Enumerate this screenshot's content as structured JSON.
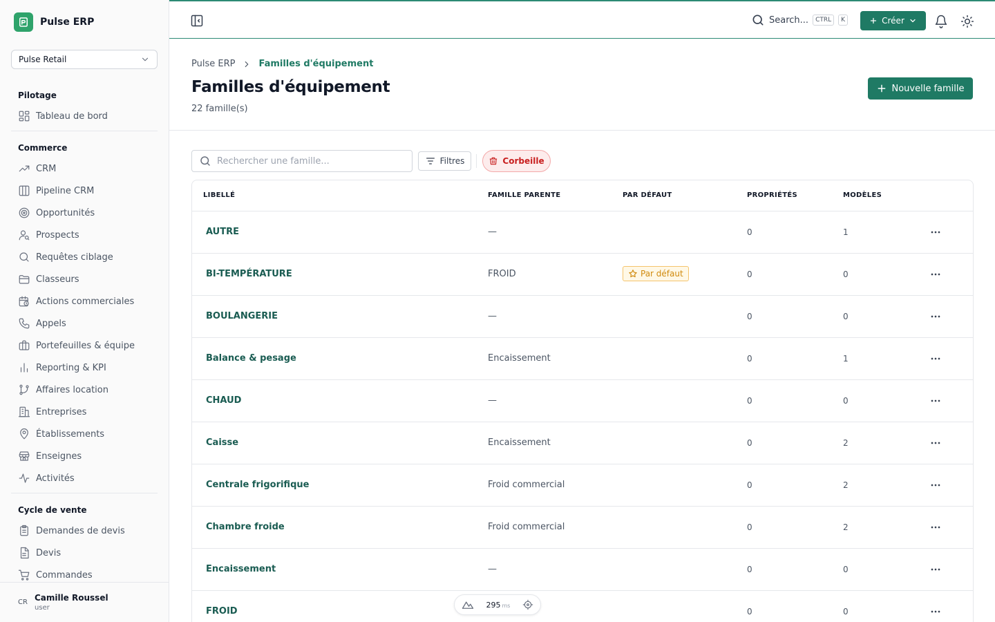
{
  "app": {
    "name": "Pulse ERP"
  },
  "org_select": {
    "value": "Pulse Retail"
  },
  "sidebar": {
    "sections": [
      {
        "title": "Pilotage",
        "items": [
          {
            "label": "Tableau de bord",
            "icon": "dashboard-icon"
          }
        ]
      },
      {
        "title": "Commerce",
        "items": [
          {
            "label": "CRM",
            "icon": "trend-icon"
          },
          {
            "label": "Pipeline CRM",
            "icon": "columns-icon"
          },
          {
            "label": "Opportunités",
            "icon": "target-icon"
          },
          {
            "label": "Prospects",
            "icon": "user-search-icon"
          },
          {
            "label": "Requêtes ciblage",
            "icon": "search-icon"
          },
          {
            "label": "Classeurs",
            "icon": "folder-icon"
          },
          {
            "label": "Actions commerciales",
            "icon": "calendar-clock-icon"
          },
          {
            "label": "Appels",
            "icon": "phone-icon"
          },
          {
            "label": "Portefeuilles & équipe",
            "icon": "briefcase-icon"
          },
          {
            "label": "Reporting & KPI",
            "icon": "bar-chart-icon"
          },
          {
            "label": "Affaires location",
            "icon": "git-branch-icon"
          },
          {
            "label": "Entreprises",
            "icon": "building-icon"
          },
          {
            "label": "Établissements",
            "icon": "map-pin-icon"
          },
          {
            "label": "Enseignes",
            "icon": "store-icon"
          },
          {
            "label": "Activités",
            "icon": "activity-icon"
          }
        ]
      },
      {
        "title": "Cycle de vente",
        "items": [
          {
            "label": "Demandes de devis",
            "icon": "clipboard-icon"
          },
          {
            "label": "Devis",
            "icon": "file-text-icon"
          },
          {
            "label": "Commandes",
            "icon": "cart-icon"
          }
        ]
      }
    ]
  },
  "user": {
    "initials": "CR",
    "name": "Camille Roussel",
    "role": "user"
  },
  "topbar": {
    "search_label": "Search...",
    "kbd_ctrl": "CTRL",
    "kbd_k": "K",
    "create_label": "Créer"
  },
  "breadcrumb": {
    "root": "Pulse ERP",
    "current": "Familles d'équipement"
  },
  "page": {
    "title": "Familles d'équipement",
    "count": "22 famille(s)",
    "new_button": "Nouvelle famille"
  },
  "toolbar": {
    "search_placeholder": "Rechercher une famille...",
    "filters_label": "Filtres",
    "trash_label": "Corbeille"
  },
  "table": {
    "columns": [
      "LIBELLÉ",
      "FAMILLE PARENTE",
      "PAR DÉFAUT",
      "PROPRIÉTÉS",
      "MODÈLES"
    ],
    "default_badge": "Par défaut",
    "rows": [
      {
        "label": "AUTRE",
        "parent": "—",
        "is_default": false,
        "props": "0",
        "models": "1"
      },
      {
        "label": "BI-TEMPÉRATURE",
        "parent": "FROID",
        "is_default": true,
        "props": "0",
        "models": "0"
      },
      {
        "label": "BOULANGERIE",
        "parent": "—",
        "is_default": false,
        "props": "0",
        "models": "0"
      },
      {
        "label": "Balance & pesage",
        "parent": "Encaissement",
        "is_default": false,
        "props": "0",
        "models": "1"
      },
      {
        "label": "CHAUD",
        "parent": "—",
        "is_default": false,
        "props": "0",
        "models": "0"
      },
      {
        "label": "Caisse",
        "parent": "Encaissement",
        "is_default": false,
        "props": "0",
        "models": "2"
      },
      {
        "label": "Centrale frigorifique",
        "parent": "Froid commercial",
        "is_default": false,
        "props": "0",
        "models": "2"
      },
      {
        "label": "Chambre froide",
        "parent": "Froid commercial",
        "is_default": false,
        "props": "0",
        "models": "2"
      },
      {
        "label": "Encaissement",
        "parent": "—",
        "is_default": false,
        "props": "0",
        "models": "0"
      },
      {
        "label": "FROID",
        "parent": "",
        "is_default": false,
        "props": "0",
        "models": "0"
      }
    ]
  },
  "perf": {
    "value": "295",
    "unit": "ms"
  },
  "colors": {
    "accent": "#1f7a64",
    "brand": "#2fa36b",
    "danger": "#c81e1e",
    "warning": "#d08a0e"
  }
}
